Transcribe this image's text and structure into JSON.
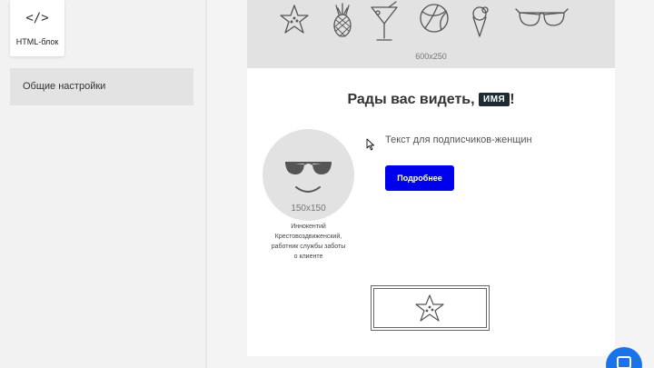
{
  "sidebar": {
    "html_block": {
      "icon": "</>",
      "label": "HTML-блок"
    },
    "general_settings": "Общие настройки"
  },
  "email": {
    "banner": {
      "size_label": "600x250",
      "icons": [
        "starfish-icon",
        "pineapple-icon",
        "cocktail-icon",
        "beach-ball-icon",
        "ice-cream-icon",
        "sunglasses-icon"
      ]
    },
    "greeting": {
      "text": "Рады вас видеть, ",
      "name_tag": "ИМЯ",
      "punct": "!"
    },
    "avatar": {
      "size_label": "150x150",
      "icon": "sunglasses-smile-icon"
    },
    "caption_lines": [
      "Иннокентий",
      "Крестовоздвиженский,",
      "работник службы заботы",
      "о клиенте"
    ],
    "body_text": "Текст для подписчиков-женщин",
    "button_label": "Подробнее",
    "footer_icon": "starfish-icon"
  },
  "colors": {
    "accent_button": "#0000ee",
    "name_tag_bg": "#1c2a33",
    "chat_bubble": "#1a73e8"
  }
}
